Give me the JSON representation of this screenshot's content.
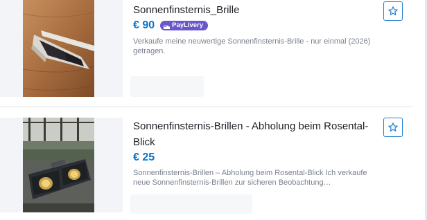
{
  "listings": [
    {
      "title": "Sonnenfinsternis_Brille",
      "price": "€ 90",
      "badge": "PayLivery",
      "description": "Verkaufe meine neuwertige Sonnenfinsternis-Brille - nur einmal (2026) getragen.",
      "image_subject": "eclipse glasses on wooden table"
    },
    {
      "title": "Sonnenfinsternis-Brillen - Abholung beim Rosental-Blick",
      "price": "€ 25",
      "description": "Sonnenfinsternis-Brillen – Abholung beim Rosental-Blick Ich verkaufe neue Sonnenfinsternis-Brillen zur sicheren Beobachtung…",
      "image_subject": "eclipse glasses in front of window"
    }
  ],
  "icons": {
    "favorite": "star-outline-icon",
    "badge": "paylivery-icon"
  },
  "colors": {
    "accent": "#0a73c9",
    "badge": "#6b57c9",
    "text": "#1c1f26",
    "muted": "#7a818e"
  }
}
